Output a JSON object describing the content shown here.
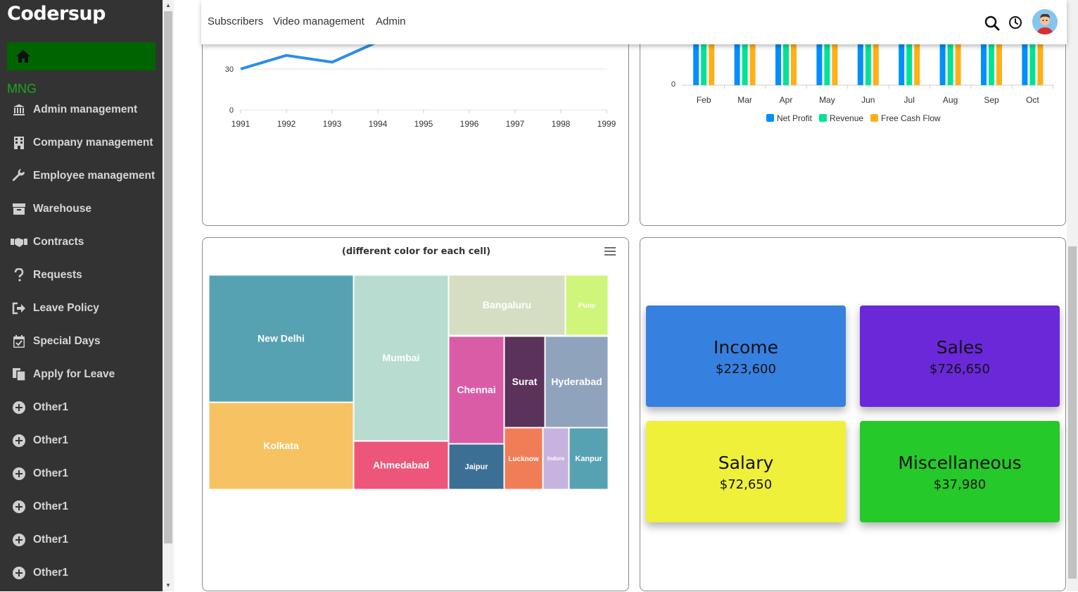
{
  "brand": "Codersup",
  "sidebar": {
    "section_label": "MNG",
    "items": [
      {
        "label": "Admin management",
        "icon": "bank-icon"
      },
      {
        "label": "Company management",
        "icon": "building-icon"
      },
      {
        "label": "Employee management",
        "icon": "wrench-icon"
      },
      {
        "label": "Warehouse",
        "icon": "archive-icon"
      },
      {
        "label": "Contracts",
        "icon": "handshake-icon"
      },
      {
        "label": "Requests",
        "icon": "question-icon"
      },
      {
        "label": "Leave Policy",
        "icon": "sign-out-icon"
      },
      {
        "label": "Special Days",
        "icon": "calendar-check-icon"
      },
      {
        "label": "Apply for Leave",
        "icon": "copy-icon"
      },
      {
        "label": "Other1",
        "icon": "plus-circle-icon"
      },
      {
        "label": "Other1",
        "icon": "plus-circle-icon"
      },
      {
        "label": "Other1",
        "icon": "plus-circle-icon"
      },
      {
        "label": "Other1",
        "icon": "plus-circle-icon"
      },
      {
        "label": "Other1",
        "icon": "plus-circle-icon"
      },
      {
        "label": "Other1",
        "icon": "plus-circle-icon"
      }
    ]
  },
  "topbar": {
    "links": [
      "Subscribers",
      "Video management",
      "Admin"
    ]
  },
  "charts": {
    "line": {
      "type": "line",
      "x": [
        1991,
        1992,
        1993,
        1994,
        1995,
        1996,
        1997,
        1998,
        1999
      ],
      "y_ticks": [
        0,
        30
      ],
      "visible_values": [
        30,
        40,
        35,
        50
      ],
      "color": "#2b8ee8"
    },
    "bar": {
      "type": "bar",
      "categories": [
        "Feb",
        "Mar",
        "Apr",
        "May",
        "Jun",
        "Jul",
        "Aug",
        "Sep",
        "Oct"
      ],
      "y_ticks": [
        0
      ],
      "series": [
        {
          "name": "Net Profit",
          "color": "#008ffb"
        },
        {
          "name": "Revenue",
          "color": "#00e396"
        },
        {
          "name": "Free Cash Flow",
          "color": "#feb019"
        }
      ]
    },
    "treemap": {
      "type": "treemap",
      "title": "(different color for each cell)",
      "cells": [
        {
          "name": "New Delhi",
          "color": "#57a2b2"
        },
        {
          "name": "Kolkata",
          "color": "#f6c262"
        },
        {
          "name": "Mumbai",
          "color": "#b8ddd0"
        },
        {
          "name": "Ahmedabad",
          "color": "#ee557a"
        },
        {
          "name": "Bangaluru",
          "color": "#d5dec3"
        },
        {
          "name": "Pune",
          "color": "#cff57a"
        },
        {
          "name": "Chennai",
          "color": "#db5ca6"
        },
        {
          "name": "Surat",
          "color": "#5a325a"
        },
        {
          "name": "Hyderabad",
          "color": "#8fa3bd"
        },
        {
          "name": "Jaipur",
          "color": "#3c6f94"
        },
        {
          "name": "Lucknow",
          "color": "#f07d55"
        },
        {
          "name": "Indore",
          "color": "#c6b3e0"
        },
        {
          "name": "Kanpur",
          "color": "#57a2b2"
        }
      ]
    }
  },
  "stats": [
    {
      "title": "Income",
      "value": "$223,600",
      "color": "#3680e0"
    },
    {
      "title": "Sales",
      "value": "$726,650",
      "color": "#6a28d9"
    },
    {
      "title": "Salary",
      "value": "$72,650",
      "color": "#eff03a"
    },
    {
      "title": "Miscellaneous",
      "value": "$37,980",
      "color": "#25c92a"
    }
  ]
}
